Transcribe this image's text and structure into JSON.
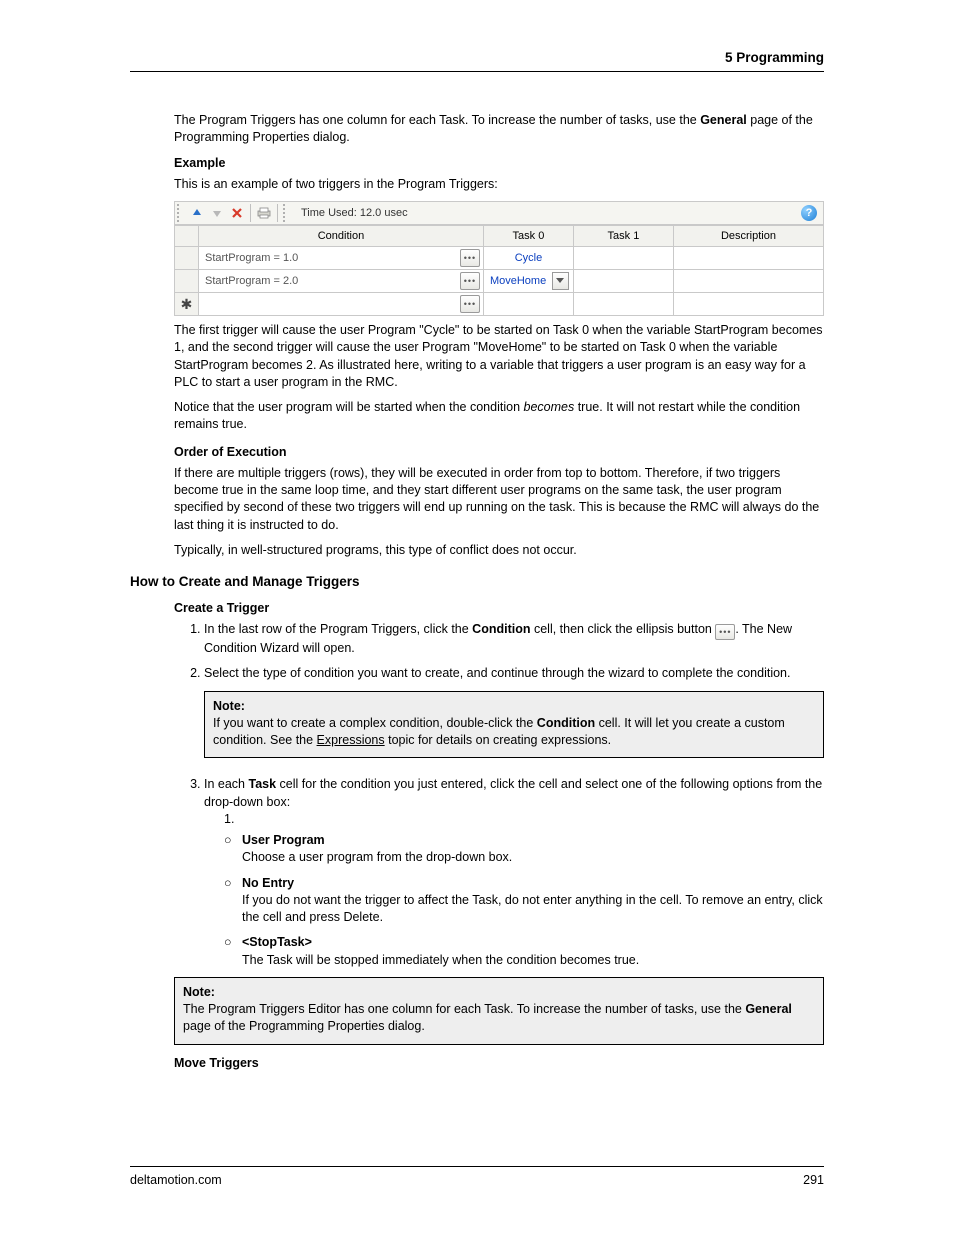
{
  "header": {
    "chapter": "5  Programming"
  },
  "footer": {
    "site": "deltamotion.com",
    "page": "291"
  },
  "intro": {
    "p1a": "The Program Triggers has one column for each Task. To increase the number of tasks, use the ",
    "p1b": "General",
    "p1c": " page of the Programming Properties dialog."
  },
  "example": {
    "heading": "Example",
    "intro": "This is an example of two triggers in the Program Triggers:",
    "toolbar": {
      "time_used": "Time Used: 12.0 usec",
      "help": "?"
    },
    "columns": {
      "condition": "Condition",
      "task0": "Task 0",
      "task1": "Task 1",
      "description": "Description"
    },
    "rows": [
      {
        "condition": "StartProgram = 1.0",
        "task0": "Cycle"
      },
      {
        "condition": "StartProgram = 2.0",
        "task0": "MoveHome",
        "dropdown": true
      }
    ],
    "after1": "The first trigger will cause the user Program \"Cycle\" to be started on Task 0 when the variable StartProgram becomes 1, and the second trigger will cause the user Program \"MoveHome\" to be started on Task 0 when the variable StartProgram becomes 2. As illustrated here, writing to a variable that triggers a user program is an easy way for a PLC to start a user program in the RMC.",
    "after2a": "Notice that the user program will be started when the condition ",
    "after2b": "becomes",
    "after2c": " true. It will not restart while the condition remains true."
  },
  "order": {
    "heading": "Order of Execution",
    "p1": "If there are multiple triggers (rows), they will be executed in order from top to bottom. Therefore, if two triggers become true in the same loop time, and they start different user programs on the same task, the user program specified by second of these two triggers will end up running on the task. This is because the RMC will always do the last thing it is instructed to do.",
    "p2": "Typically, in well-structured programs, this type of conflict does not occur."
  },
  "howto": {
    "heading": "How to Create and Manage Triggers",
    "create": {
      "heading": "Create a Trigger",
      "s1a": "In the last row of the Program Triggers, click the ",
      "s1b": "Condition",
      "s1c": " cell, then click the ellipsis button ",
      "s1d": ". The New Condition Wizard will open.",
      "s2": "Select the type of condition you want to create, and continue through the wizard to complete the condition.",
      "note1": {
        "title": "Note:",
        "a": "If you want to create a complex condition, double-click the ",
        "b": "Condition",
        "c": " cell. It will let you create a custom condition. See the ",
        "link": "Expressions",
        "d": " topic for details on creating expressions."
      },
      "s3a": "In each ",
      "s3b": "Task",
      "s3c": " cell for the condition you just entered, click the cell and select one of the following options from the drop-down box:",
      "sub": {
        "num": "1.",
        "o1t": "User Program",
        "o1d": "Choose a user program from the drop-down box.",
        "o2t": "No Entry",
        "o2d": "If you do not want the trigger to affect the Task, do not enter anything in the cell. To remove an entry, click the cell and press Delete.",
        "o3t": "<StopTask>",
        "o3d": "The Task will be stopped immediately when the condition becomes true."
      },
      "note2": {
        "title": "Note:",
        "a": "The Program Triggers Editor has one column for each Task. To increase the number of tasks, use the ",
        "b": "General",
        "c": " page of the Programming Properties dialog."
      }
    },
    "move": {
      "heading": "Move Triggers"
    }
  }
}
